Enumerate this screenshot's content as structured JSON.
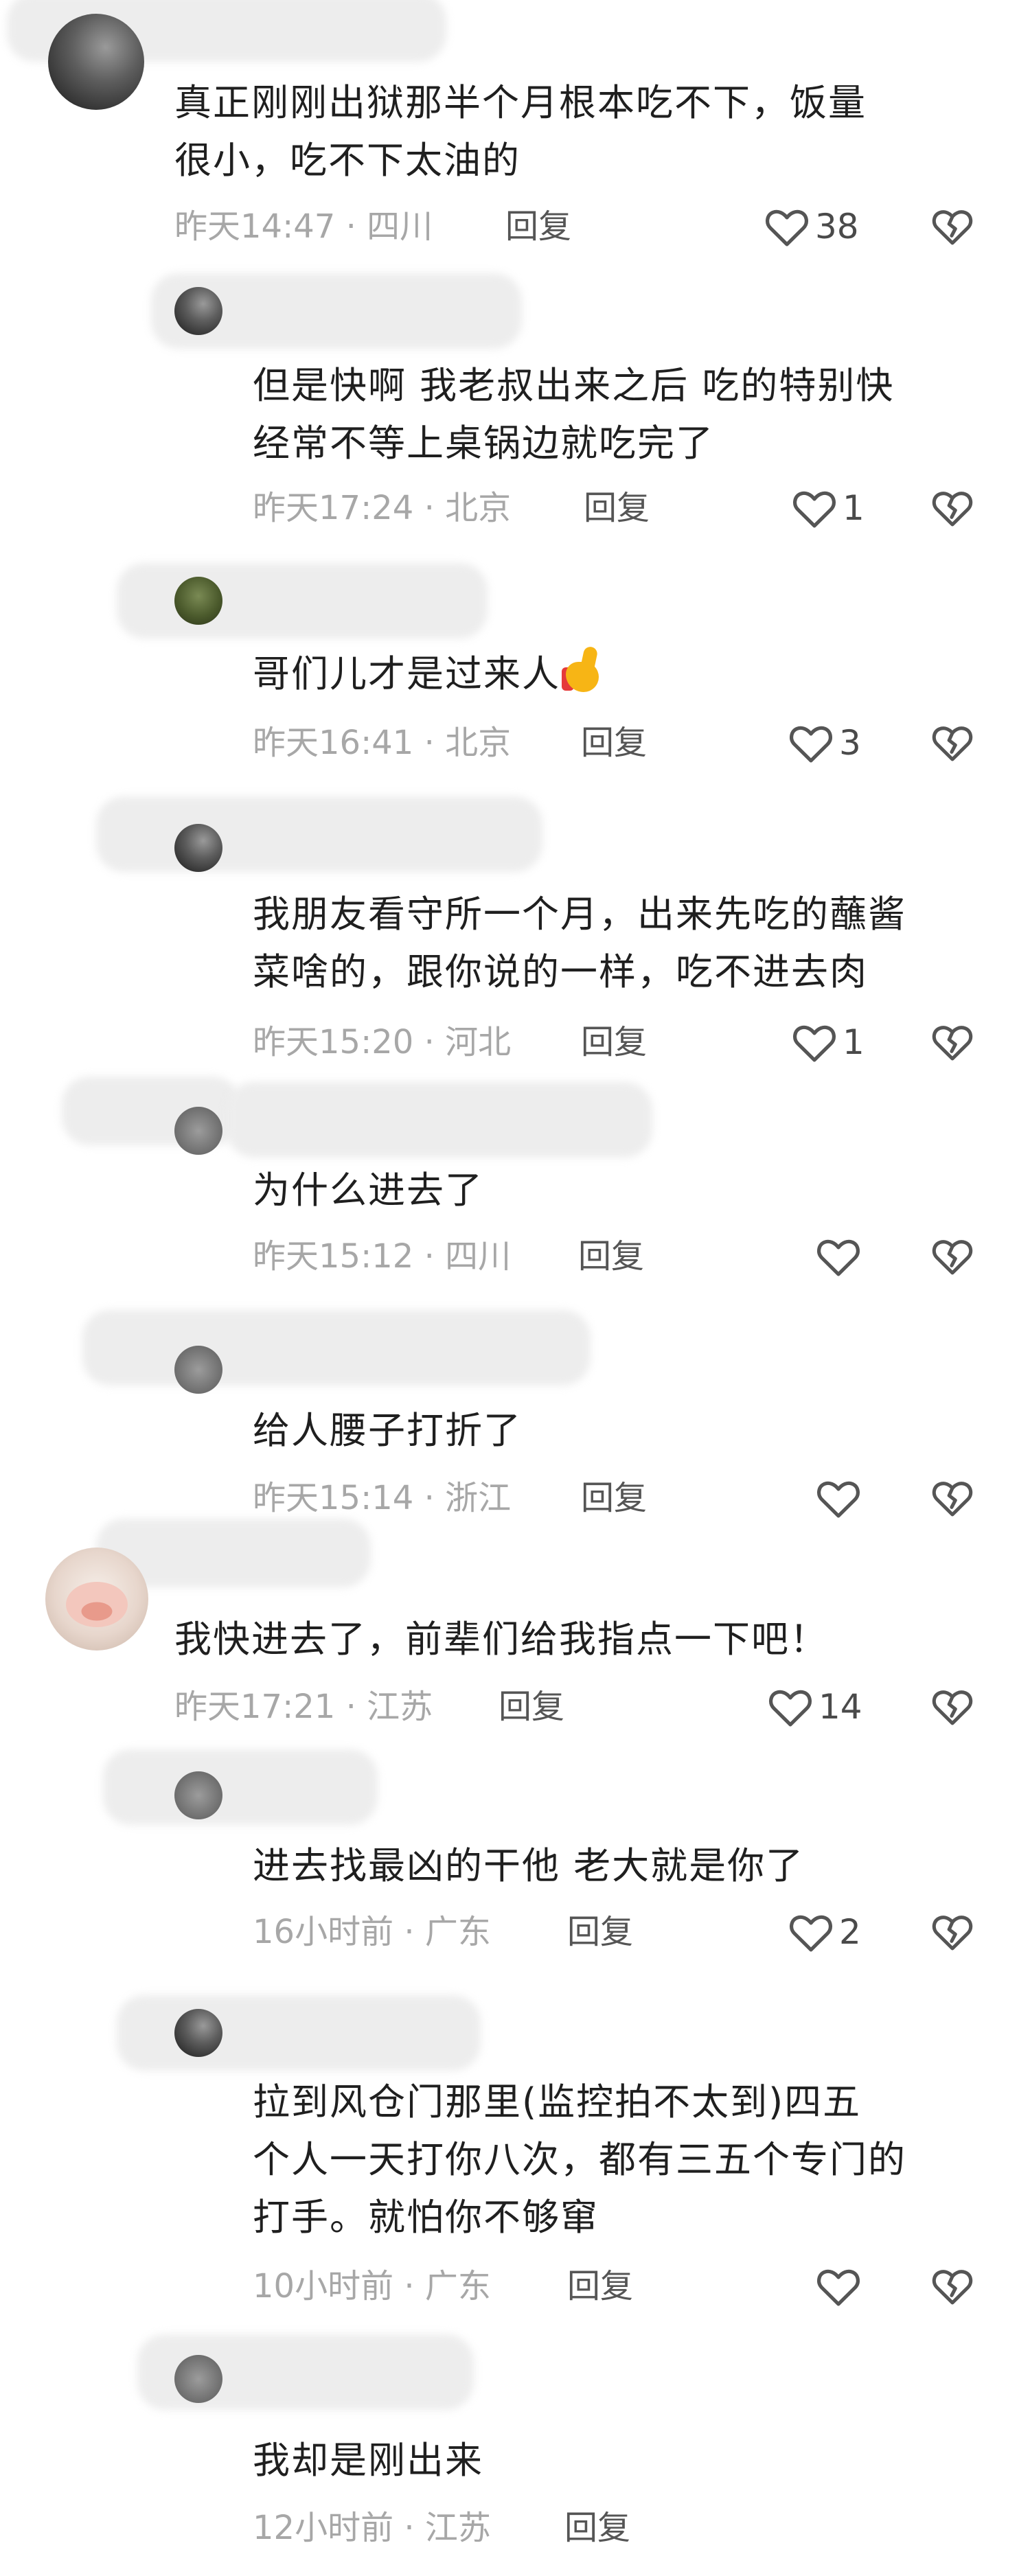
{
  "comments": [
    {
      "text": "真正刚刚出狱那半个月根本吃不下，饭量\n很小，吃不下太油的",
      "time": "昨天14:47",
      "location": "四川",
      "likes": "38"
    },
    {
      "text": "但是快啊 我老叔出来之后 吃的特别快\n经常不等上桌锅边就吃完了",
      "time": "昨天17:24",
      "location": "北京",
      "likes": "1"
    },
    {
      "text": "哥们儿才是过来人",
      "time": "昨天16:41",
      "location": "北京",
      "likes": "3"
    },
    {
      "text": "我朋友看守所一个月，出来先吃的蘸酱\n菜啥的，跟你说的一样，吃不进去肉",
      "time": "昨天15:20",
      "location": "河北",
      "likes": "1"
    },
    {
      "text": "为什么进去了",
      "time": "昨天15:12",
      "location": "四川",
      "likes": ""
    },
    {
      "text": "给人腰子打折了",
      "time": "昨天15:14",
      "location": "浙江",
      "likes": ""
    },
    {
      "text": "我快进去了，前辈们给我指点一下吧！",
      "time": "昨天17:21",
      "location": "江苏",
      "likes": "14"
    },
    {
      "text": "进去找最凶的干他 老大就是你了",
      "time": "16小时前",
      "location": "广东",
      "likes": "2"
    },
    {
      "text": "拉到风仓门那里(监控拍不太到)四五\n个人一天打你八次，都有三五个专门的\n打手。就怕你不够窜",
      "time": "10小时前",
      "location": "广东",
      "likes": ""
    },
    {
      "text": "我却是刚出来",
      "time": "12小时前",
      "location": "江苏",
      "likes": ""
    }
  ],
  "labels": {
    "reply": "回复",
    "meta_sep": "·"
  },
  "icons": {
    "like": "heart-outline-icon",
    "dislike": "broken-heart-icon",
    "emoji": "thumbs-up-emoji"
  },
  "colors": {
    "text": "#1f1f1f",
    "meta": "#a7a7a7",
    "reply": "#555555",
    "icon": "#555555"
  }
}
